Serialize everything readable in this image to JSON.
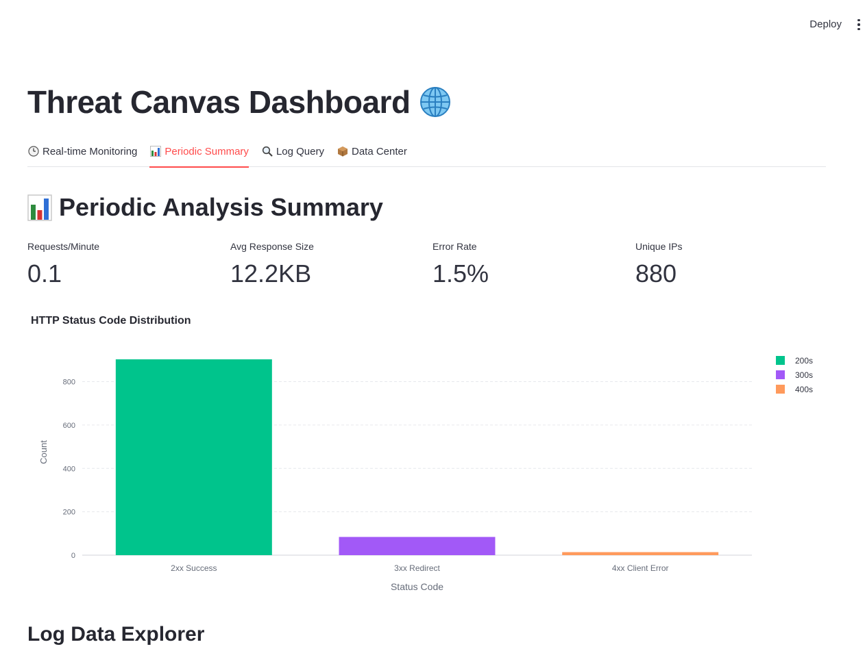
{
  "topbar": {
    "deploy_label": "Deploy"
  },
  "page": {
    "title": "Threat Canvas Dashboard"
  },
  "tabs": [
    {
      "icon": "clock-icon",
      "label": "Real-time Monitoring",
      "active": false
    },
    {
      "icon": "bar-chart-icon",
      "label": "Periodic Summary",
      "active": true
    },
    {
      "icon": "magnifier-icon",
      "label": "Log Query",
      "active": false
    },
    {
      "icon": "package-icon",
      "label": "Data Center",
      "active": false
    }
  ],
  "section": {
    "title": "Periodic Analysis Summary"
  },
  "metrics": [
    {
      "label": "Requests/Minute",
      "value": "0.1"
    },
    {
      "label": "Avg Response Size",
      "value": "12.2KB"
    },
    {
      "label": "Error Rate",
      "value": "1.5%"
    },
    {
      "label": "Unique IPs",
      "value": "880"
    }
  ],
  "chart_title": "HTTP Status Code Distribution",
  "chart_data": {
    "type": "bar",
    "categories": [
      "2xx Success",
      "3xx Redirect",
      "4xx Client Error"
    ],
    "series": [
      {
        "name": "200s",
        "values": [
          903,
          null,
          null
        ],
        "color": "#00c48c"
      },
      {
        "name": "300s",
        "values": [
          null,
          84,
          null
        ],
        "color": "#a259f7"
      },
      {
        "name": "400s",
        "values": [
          null,
          null,
          14
        ],
        "color": "#ff9a5c"
      }
    ],
    "xlabel": "Status Code",
    "ylabel": "Count",
    "ylim": [
      0,
      950
    ],
    "yticks": [
      0,
      200,
      400,
      600,
      800
    ],
    "grid": true,
    "legend": "top-right"
  },
  "explorer": {
    "title": "Log Data Explorer"
  }
}
